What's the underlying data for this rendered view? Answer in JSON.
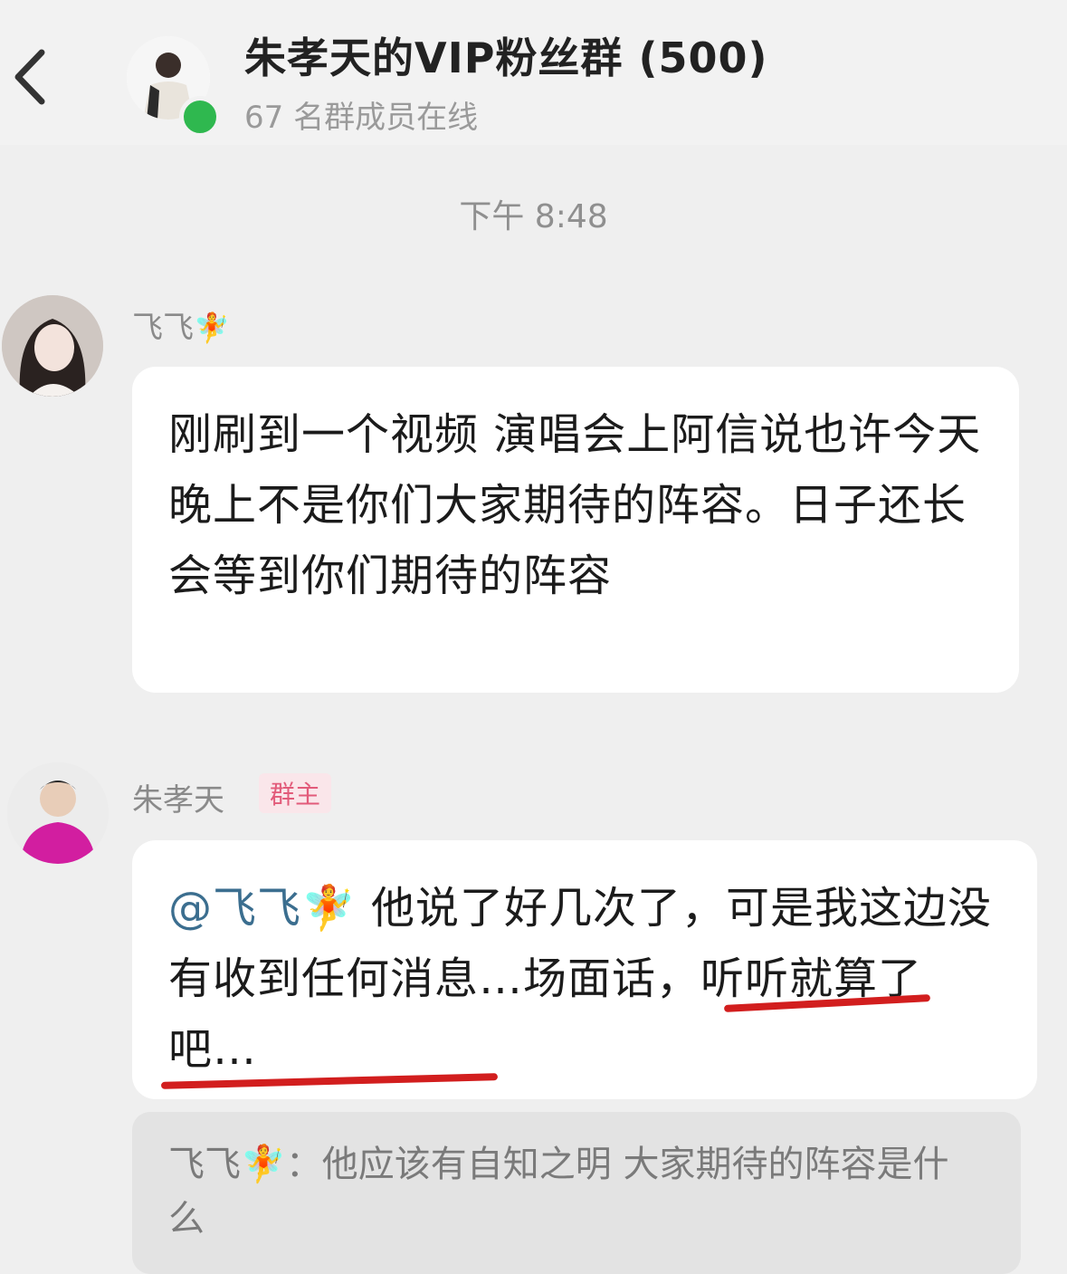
{
  "header": {
    "back_icon": "chevron-left-icon",
    "group_name": "朱孝天的VIP粉丝群",
    "member_count": "(500)",
    "online_status": "67 名群成员在线"
  },
  "timestamp": "下午 8:48",
  "messages": [
    {
      "sender": "飞飞",
      "sender_emoji": "🧚",
      "text": "刚刷到一个视频 演唱会上阿信说也许今天晚上不是你们大家期待的阵容。日子还长 会等到你们期待的阵容"
    },
    {
      "sender": "朱孝天",
      "badge": "群主",
      "mention": "@飞飞🧚",
      "text": " 他说了好几次了，可是我这边没有收到任何消息…场面话，听听就算了吧…",
      "quote": {
        "sender": "飞飞🧚",
        "text": "：他应该有自知之明  大家期待的阵容是什么"
      }
    }
  ],
  "colors": {
    "background": "#efefef",
    "bubble": "#ffffff",
    "online": "#2fb84f",
    "underline": "#d21e1e",
    "badge_text": "#e25b7a"
  }
}
